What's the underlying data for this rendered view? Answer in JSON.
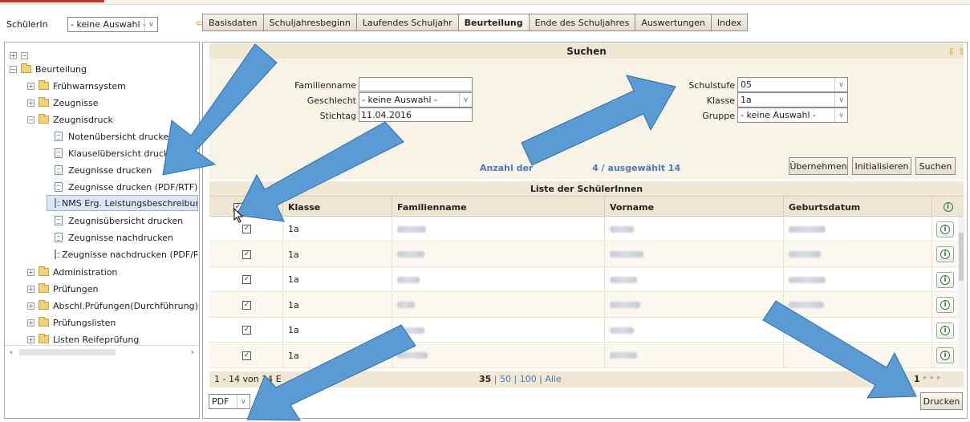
{
  "header": {
    "student_label": "SchülerIn",
    "student_select": "- keine Auswahl -",
    "back_icon": "back-arrow-icon"
  },
  "tabs": [
    {
      "label": "Basisdaten",
      "active": false
    },
    {
      "label": "Schuljahresbeginn",
      "active": false
    },
    {
      "label": "Laufendes Schuljahr",
      "active": false
    },
    {
      "label": "Beurteilung",
      "active": true
    },
    {
      "label": "Ende des Schuljahres",
      "active": false
    },
    {
      "label": "Auswertungen",
      "active": false
    },
    {
      "label": "Index",
      "active": false
    }
  ],
  "tree": {
    "root": "Beurteilung",
    "items": [
      {
        "label": "Frühwarnsystem",
        "type": "folder"
      },
      {
        "label": "Zeugnisse",
        "type": "folder"
      },
      {
        "label": "Zeugnisdruck",
        "type": "folder-open"
      },
      {
        "label": "Notenübersicht drucken",
        "type": "doc"
      },
      {
        "label": "Klauselübersicht drucken",
        "type": "doc"
      },
      {
        "label": "Zeugnisse drucken",
        "type": "doc"
      },
      {
        "label": "Zeugnisse drucken (PDF/RTF)",
        "type": "doc"
      },
      {
        "label": "NMS Erg. Leistungsbeschreibun",
        "type": "doc",
        "selected": true
      },
      {
        "label": "Zeugnisübersicht drucken",
        "type": "doc"
      },
      {
        "label": "Zeugnisse nachdrucken",
        "type": "doc"
      },
      {
        "label": "Zeugnisse nachdrucken (PDF/RT",
        "type": "doc"
      },
      {
        "label": "Administration",
        "type": "folder"
      },
      {
        "label": "Prüfungen",
        "type": "folder"
      },
      {
        "label": "Abschl.Prüfungen(Durchführung)",
        "type": "folder"
      },
      {
        "label": "Prüfungslisten",
        "type": "folder"
      },
      {
        "label": "Listen Reifeprüfung",
        "type": "folder"
      }
    ]
  },
  "search": {
    "title": "Suchen",
    "familienname_label": "Familienname",
    "familienname_value": "",
    "geschlecht_label": "Geschlecht",
    "geschlecht_value": "- keine Auswahl -",
    "stichtag_label": "Stichtag",
    "stichtag_value": "11.04.2016",
    "schulstufe_label": "Schulstufe",
    "schulstufe_value": "05",
    "klasse_label": "Klasse",
    "klasse_value": "1a",
    "gruppe_label": "Gruppe",
    "gruppe_value": "- keine Auswahl -",
    "count_text_left": "Anzahl der",
    "count_text_right": "4 / ausgewählt  14",
    "buttons": {
      "uebernehmen": "Übernehmen",
      "initialisieren": "Initialisieren",
      "suchen": "Suchen"
    }
  },
  "list": {
    "title": "Liste der SchülerInnen",
    "columns": [
      "",
      "Klasse",
      "Familienname",
      "Vorname",
      "Geburtsdatum",
      ""
    ],
    "rows": [
      {
        "klasse": "1a",
        "checked": true
      },
      {
        "klasse": "1a",
        "checked": true
      },
      {
        "klasse": "1a",
        "checked": true
      },
      {
        "klasse": "1a",
        "checked": true
      },
      {
        "klasse": "1a",
        "checked": true
      },
      {
        "klasse": "1a",
        "checked": true
      }
    ]
  },
  "pager": {
    "range": "1 - 14 von 14 E",
    "sizes": [
      "35",
      "50",
      "100",
      "Alle"
    ],
    "current_page": "1"
  },
  "footer": {
    "format": "PDF",
    "print_button": "Drucken"
  },
  "colors": {
    "header_bg": "#efe7d3",
    "search_bg": "#f8f3e7",
    "link_blue": "#4a79c0",
    "overlay_arrow": "#5b9bd5"
  }
}
